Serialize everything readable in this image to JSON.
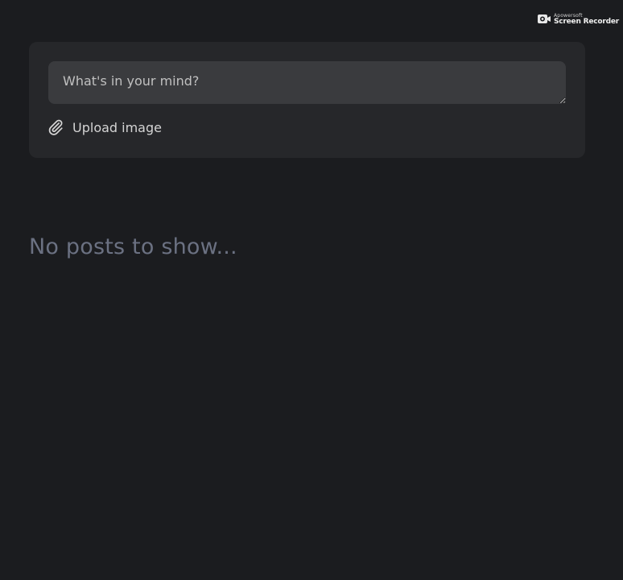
{
  "watermark": {
    "brand": "Apowersoft",
    "product": "Screen Recorder",
    "icon": "camera-icon"
  },
  "composer": {
    "placeholder": "What's in your mind?",
    "value": "",
    "upload_label": "Upload image",
    "upload_icon": "paperclip-icon"
  },
  "feed": {
    "empty_message": "No posts to show..."
  },
  "colors": {
    "background": "#1b1c1f",
    "card": "#26272a",
    "input": "#3a3b3e",
    "muted_text": "#6b7182"
  }
}
